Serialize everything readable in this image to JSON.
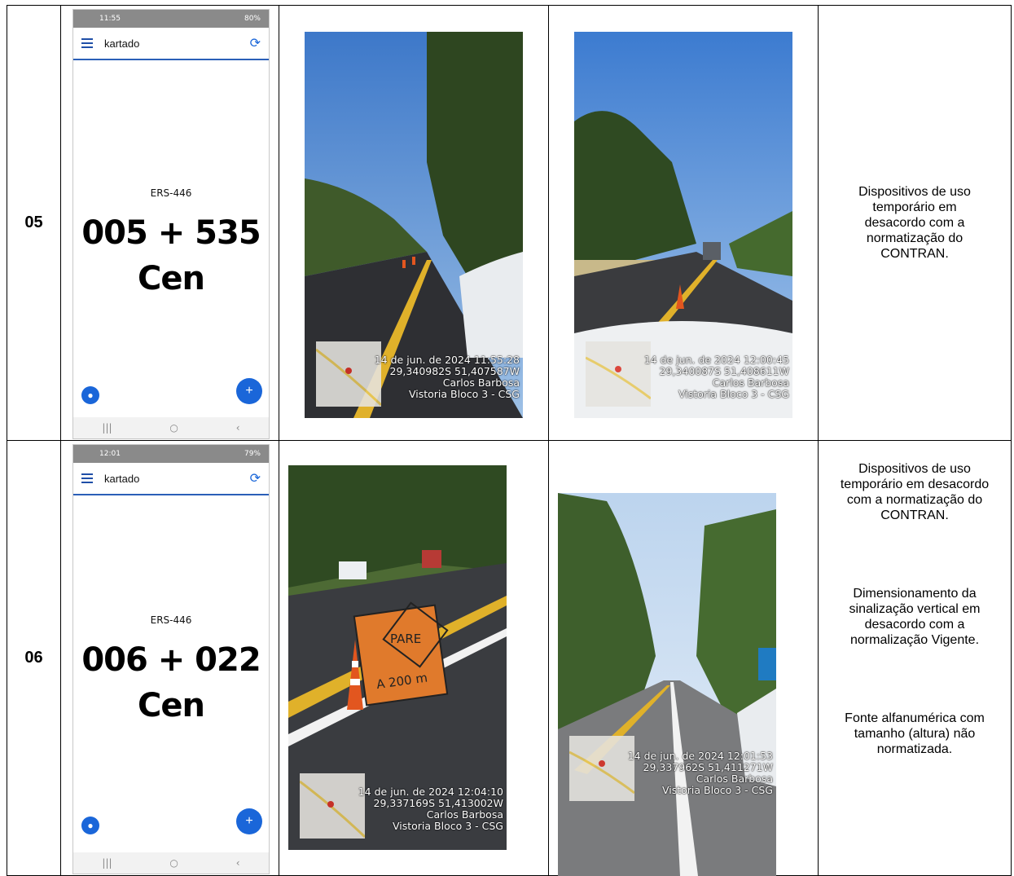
{
  "rows": [
    {
      "number": "05",
      "phone": {
        "status_time": "11:55",
        "status_right": "80%",
        "app_title": "kartado",
        "road": "ERS-446",
        "km": "005 + 535",
        "position": "Cen"
      },
      "photos": [
        {
          "date": "14 de jun. de 2024 11:55:28",
          "coords": "29,340982S 51,407587W",
          "city": "Carlos Barbosa",
          "label": "Vistoria Bloco 3 - CSG"
        },
        {
          "date": "14 de jun. de 2024 12:00:45",
          "coords": "29,340087S 51,408611W",
          "city": "Carlos Barbosa",
          "label": "Vistoria Bloco 3 - CSG"
        }
      ],
      "notes": [
        "Dispositivos de uso temporário em desacordo com a normatização do CONTRAN."
      ]
    },
    {
      "number": "06",
      "phone": {
        "status_time": "12:01",
        "status_right": "79%",
        "app_title": "kartado",
        "road": "ERS-446",
        "km": "006 + 022",
        "position": "Cen"
      },
      "photos": [
        {
          "date": "14 de jun. de 2024 12:04:10",
          "coords": "29,337169S 51,413002W",
          "city": "Carlos Barbosa",
          "label": "Vistoria Bloco 3 - CSG",
          "sign_top": "PARE",
          "sign_bottom": "A 200 m"
        },
        {
          "date": "14 de jun. de 2024 12:01:53",
          "coords": "29,337962S 51,411271W",
          "city": "Carlos Barbosa",
          "label": "Vistoria Bloco 3 - CSG"
        }
      ],
      "notes": [
        "Dispositivos de uso temporário em desacordo com a normatização do CONTRAN.",
        "Dimensionamento da sinalização vertical em desacordo com a normalização Vigente.",
        "Fonte alfanumérica com tamanho (altura) não normatizada."
      ]
    }
  ]
}
